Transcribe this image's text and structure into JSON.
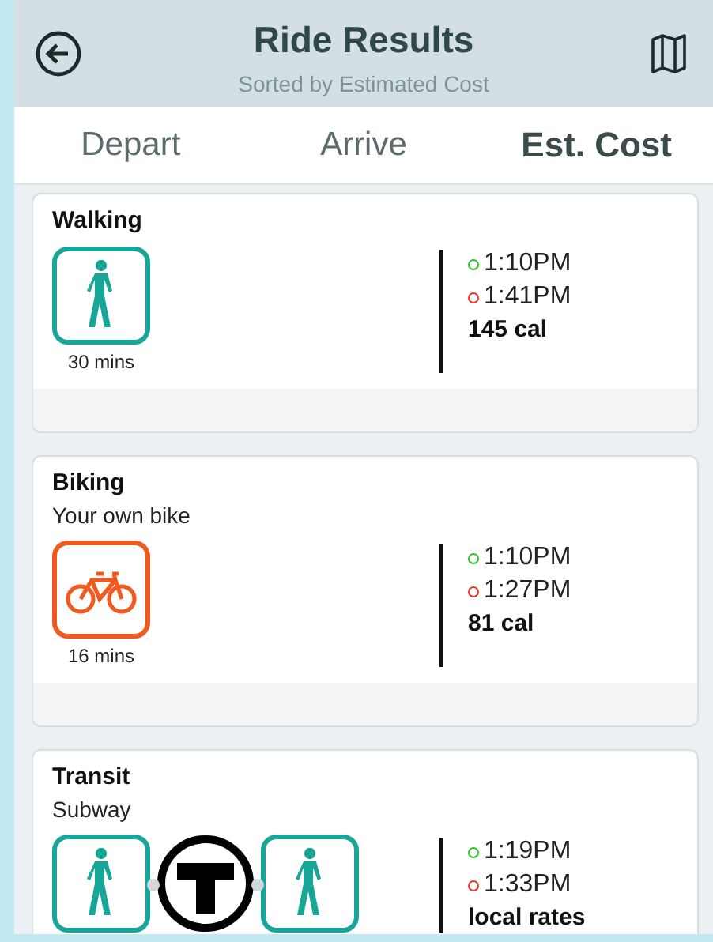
{
  "header": {
    "title": "Ride Results",
    "subtitle": "Sorted by Estimated Cost"
  },
  "tabs": [
    {
      "label": "Depart",
      "selected": false
    },
    {
      "label": "Arrive",
      "selected": false
    },
    {
      "label": "Est. Cost",
      "selected": true
    }
  ],
  "results": [
    {
      "title": "Walking",
      "legs": [
        {
          "kind": "walk",
          "duration": "30 mins"
        }
      ],
      "times": [
        {
          "text": "1:10PM",
          "color": "#2ec02e"
        },
        {
          "text": "1:41PM",
          "color": "#e8352a"
        }
      ],
      "cost": "145 cal"
    },
    {
      "title": "Biking",
      "subtitle": "Your own bike",
      "legs": [
        {
          "kind": "bike",
          "duration": "16 mins"
        }
      ],
      "times": [
        {
          "text": "1:10PM",
          "color": "#2ec02e"
        },
        {
          "text": "1:27PM",
          "color": "#e8352a"
        }
      ],
      "cost": "81 cal"
    },
    {
      "title": "Transit",
      "subtitle": "Subway",
      "legs": [
        {
          "kind": "walk"
        },
        {
          "kind": "subway"
        },
        {
          "kind": "walk"
        }
      ],
      "times": [
        {
          "text": "1:19PM",
          "color": "#2ec02e"
        },
        {
          "text": "1:33PM",
          "color": "#e8352a"
        }
      ],
      "cost": "local rates"
    }
  ]
}
